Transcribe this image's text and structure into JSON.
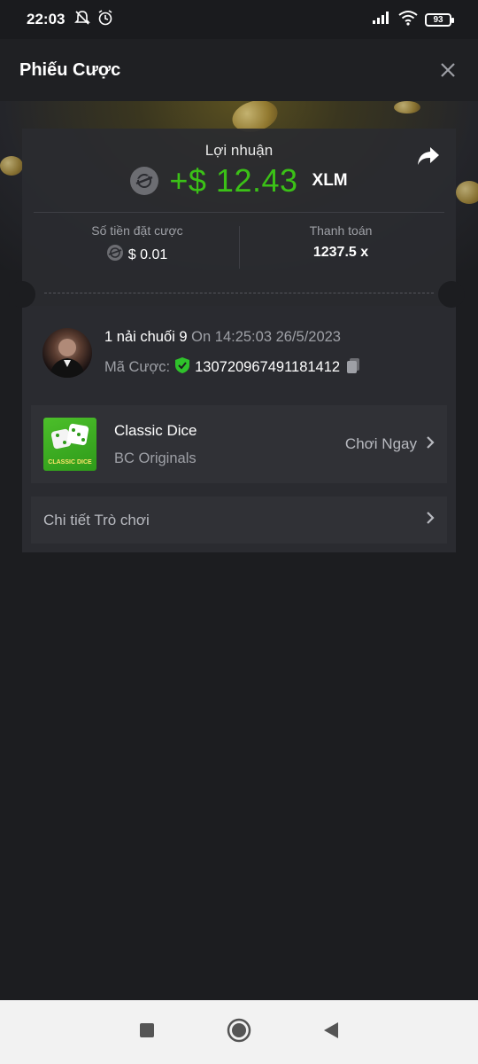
{
  "status_bar": {
    "time": "22:03",
    "battery": "93"
  },
  "header": {
    "title": "Phiếu Cược"
  },
  "profit": {
    "label": "Lợi nhuận",
    "amount": "+$ 12.43",
    "currency": "XLM"
  },
  "stats": {
    "bet_amount_label": "Số tiền đặt cược",
    "bet_amount_value": "$ 0.01",
    "payout_label": "Thanh toán",
    "payout_value": "1237.5 x"
  },
  "user": {
    "name": "1 nải chuối 9",
    "on_text": "On 14:25:03 26/5/2023",
    "bet_id_label": "Mã Cược:",
    "bet_id": "130720967491181412"
  },
  "game": {
    "name": "Classic Dice",
    "provider": "BC Originals",
    "thumb_text": "CLASSIC DICE",
    "play_label": "Chơi Ngay"
  },
  "details": {
    "label": "Chi tiết Trò chơi"
  },
  "colors": {
    "profit_green": "#3bc117",
    "verified_green": "#2fc22b",
    "background": "#1c1d20"
  },
  "icons": [
    "do-not-disturb-icon",
    "alarm-icon",
    "signal-icon",
    "wifi-icon",
    "battery-icon",
    "close-icon",
    "share-icon",
    "xlm-coin-icon",
    "verified-shield-icon",
    "copy-icon",
    "chevron-right-icon",
    "nav-recents-icon",
    "nav-home-icon",
    "nav-back-icon"
  ]
}
